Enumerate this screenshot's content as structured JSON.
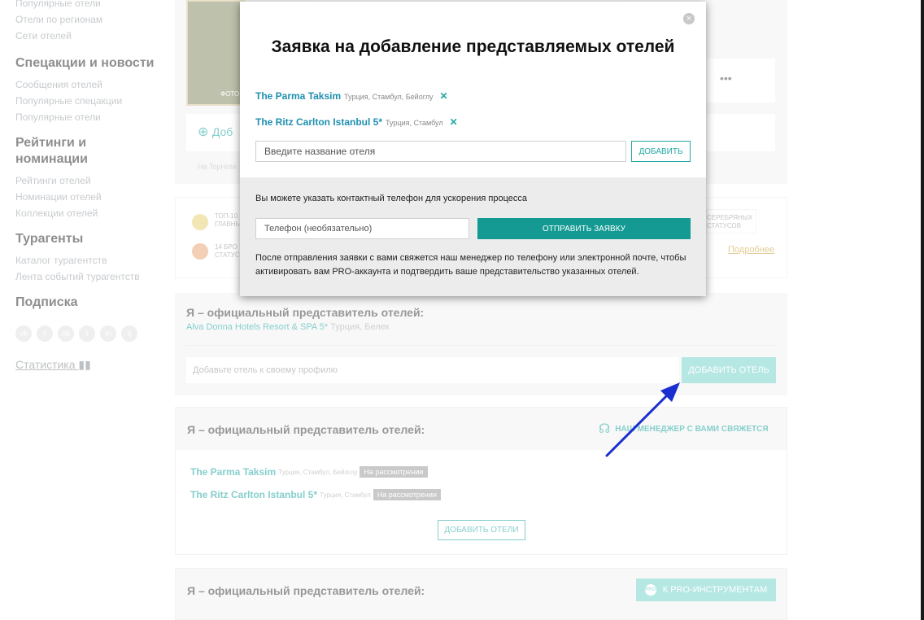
{
  "sidebar": {
    "top_links": [
      "Популярные отели",
      "Отели по регионам",
      "Сети отелей"
    ],
    "sections": [
      {
        "heading": "Спецакции и новости",
        "links": [
          "Сообщения отелей",
          "Популярные спецакции",
          "Популярные отели"
        ]
      },
      {
        "heading": "Рейтинги и номинации",
        "links": [
          "Рейтинги отелей",
          "Номинации отелей",
          "Коллекции отелей"
        ]
      },
      {
        "heading": "Турагенты",
        "links": [
          "Каталог турагентств",
          "Лента событий турагентств"
        ]
      },
      {
        "heading": "Подписка",
        "links": []
      }
    ],
    "social_icons": [
      "vk-icon",
      "facebook-icon",
      "odnoklassniki-icon",
      "twitter-icon",
      "instagram-icon",
      "livejournal-icon"
    ],
    "social_glyphs": [
      "vk",
      "f",
      "ok",
      "t",
      "in",
      "lj"
    ],
    "stats_label": "Статистика"
  },
  "background": {
    "photo_caption": "ФОТО",
    "add_partial": "Доб",
    "more_dots": "•••",
    "tophotels_partial": "На TopHote",
    "award_1": "ТОП-10 ГЛАВНЫ",
    "award_2": "14 БРО СТАТУС",
    "silver_partial": "СЕРЕБРЯНЫХ СТАТУСОВ",
    "more_link": "Подробнее",
    "rep_block_1": {
      "title": "Я – официальный представитель отелей:",
      "hotel_name": "Alva Donna Hotels Resort & SPA 5*",
      "hotel_loc": "Турция, Белек",
      "add_placeholder": "Добавьте отель к своему профилю",
      "add_button": "ДОБАВИТЬ ОТЕЛЬ"
    },
    "rep_block_2": {
      "title": "Я – официальный представитель отелей:",
      "manager_note": "НАШ МЕНЕДЖЕР С ВАМИ СВЯЖЕТСЯ",
      "hotels": [
        {
          "name": "The Parma Taksim",
          "loc": "Турция, Стамбул, Бейоглу",
          "status": "На рассмотрении"
        },
        {
          "name": "The Ritz Carlton Istanbul 5*",
          "loc": "Турция, Стамбул",
          "status": "На рассмотрении"
        }
      ],
      "add_button": "ДОБАВИТЬ ОТЕЛИ"
    },
    "rep_block_3": {
      "title": "Я – официальный представитель отелей:",
      "pro_badge": "PRO",
      "pro_button": "К PRO-ИНСТРУМЕНТАМ"
    }
  },
  "modal": {
    "title": "Заявка на добавление представляемых отелей",
    "close_glyph": "×",
    "hotels": [
      {
        "name": "The Parma Taksim",
        "loc": "Турция, Стамбул, Бейоглу"
      },
      {
        "name": "The Ritz Carlton Istanbul 5*",
        "loc": "Турция, Стамбул"
      }
    ],
    "remove_glyph": "✕",
    "hotel_input_placeholder": "Введите название отеля",
    "add_button": "ДОБАВИТЬ",
    "phone_hint": "Вы можете указать контактный телефон для ускорения процесса",
    "phone_placeholder": "Телефон (необязательно)",
    "send_button": "ОТПРАВИТЬ ЗАЯВКУ",
    "after_note": "После отправления заявки с вами свяжется наш менеджер по телефону или электронной почте, чтобы активировать вам PRO-аккаунта и подтвердить ваше представительство указанных отелей."
  },
  "colors": {
    "accent_teal": "#149a93",
    "link_blue": "#1f8fb0",
    "arrow_blue": "#1a2fd0"
  }
}
